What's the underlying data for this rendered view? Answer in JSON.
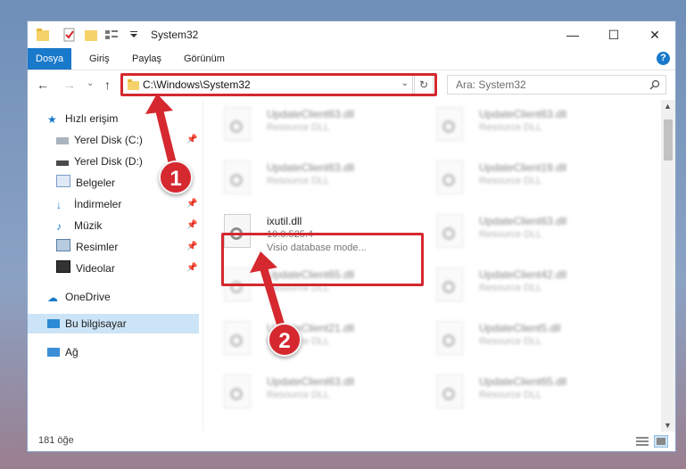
{
  "window": {
    "title": "System32",
    "controls": {
      "minimize": "—",
      "maximize": "☐",
      "close": "✕"
    }
  },
  "ribbon": {
    "tabs": [
      "Dosya",
      "Giriş",
      "Paylaş",
      "Görünüm"
    ],
    "help": "?"
  },
  "navigation": {
    "back": "←",
    "forward": "→",
    "recent": "⌄",
    "up": "↑",
    "address": "C:\\Windows\\System32",
    "refresh": "↻",
    "search_placeholder": "Ara: System32"
  },
  "sidebar": {
    "quick_access": "Hızlı erişim",
    "items": [
      "Yerel Disk (C:)",
      "Yerel Disk (D:)",
      "Belgeler",
      "İndirmeler",
      "Müzik",
      "Resimler",
      "Videolar"
    ],
    "onedrive": "OneDrive",
    "this_pc": "Bu bilgisayar",
    "network": "Ağ"
  },
  "files": {
    "highlighted": {
      "name": "ixutil.dll",
      "version": "10.0.525.4",
      "description": "Visio database mode..."
    },
    "left_column": [
      {
        "name": "UpdateClient63.dll",
        "type": "Resource DLL"
      },
      {
        "name": "UpdateClient63.dll",
        "type": "Resource DLL"
      },
      {
        "name": "UpdateClient65.dll",
        "type": "Resource DLL"
      },
      {
        "name": "UpdateClient21.dll",
        "type": "Resource DLL"
      },
      {
        "name": "UpdateClient63.dll",
        "type": "Resource DLL"
      }
    ],
    "right_column": [
      {
        "name": "UpdateClient63.dll",
        "type": "Resource DLL"
      },
      {
        "name": "UpdateClient19.dll",
        "type": "Resource DLL"
      },
      {
        "name": "UpdateClient63.dll",
        "type": "Resource DLL"
      },
      {
        "name": "UpdateClient42.dll",
        "type": "Resource DLL"
      },
      {
        "name": "UpdateClient5.dll",
        "type": "Resource DLL"
      },
      {
        "name": "UpdateClient65.dll",
        "type": "Resource DLL"
      }
    ]
  },
  "status": {
    "count": "181 öğe"
  },
  "annotations": {
    "step1": "1",
    "step2": "2",
    "color": "#d5282f"
  }
}
